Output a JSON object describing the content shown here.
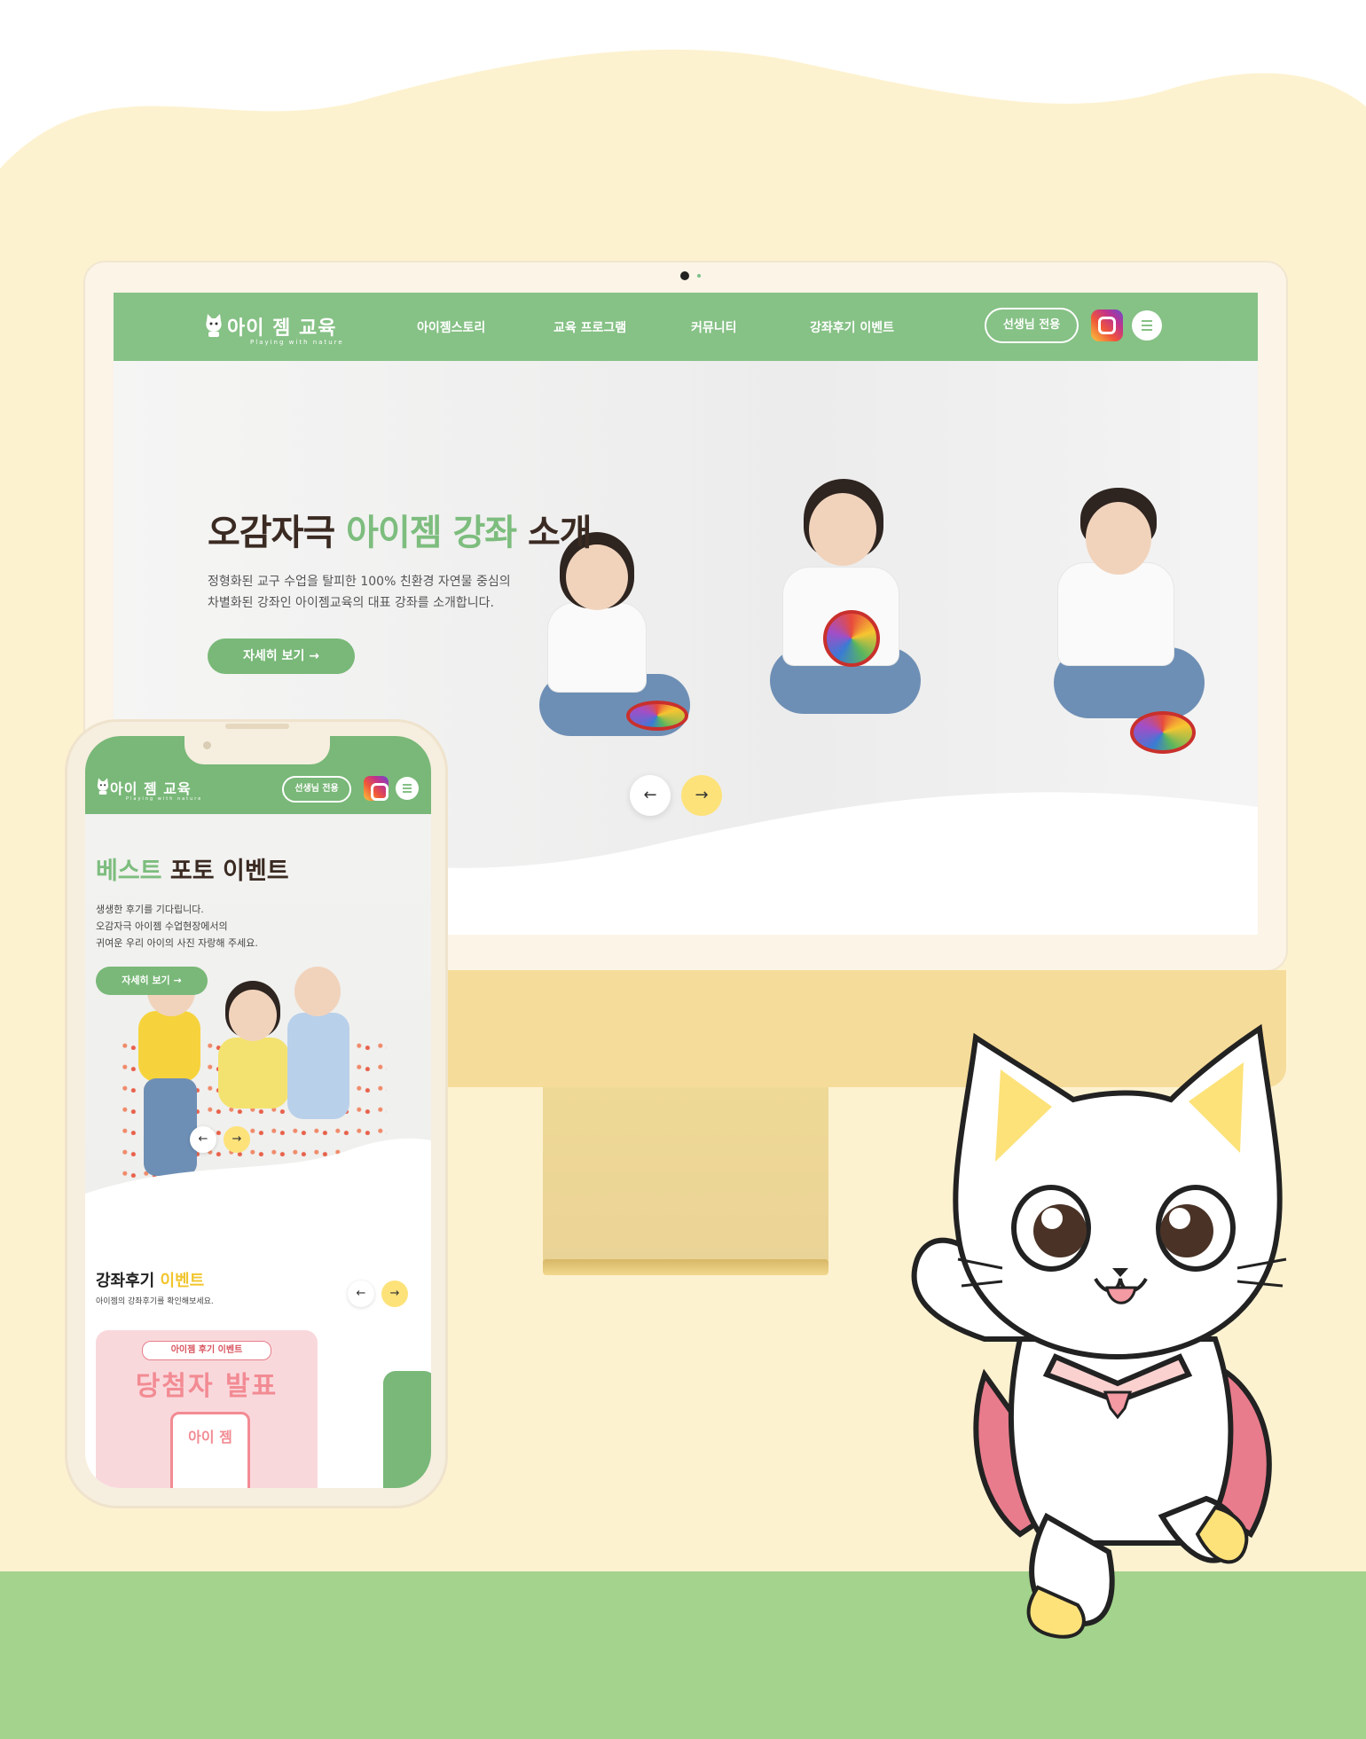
{
  "colors": {
    "cream_bg": "#fdf2d0",
    "grass": "#a3d38c",
    "brand_green": "#86c186",
    "accent_green": "#7dbd7e",
    "yellow": "#fde27a",
    "dark_text": "#3a2a22"
  },
  "desktop": {
    "logo": {
      "text": "아이 젬 교육",
      "tagline": "Playing with nature"
    },
    "nav": [
      "아이젬스토리",
      "교육 프로그램",
      "커뮤니티",
      "강좌후기 이벤트"
    ],
    "teacher_button": "선생님 전용",
    "icons": {
      "instagram": "instagram-icon",
      "menu": "hamburger-menu-icon"
    },
    "hero": {
      "title_prefix": "오감자극 ",
      "title_highlight": "아이젬 강좌",
      "title_suffix": " 소개",
      "desc_line1": "정형화된 교구 수업을 탈피한 100% 친환경 자연물 중심의",
      "desc_line2": "차별화된 강좌인 아이젬교육의 대표 강좌를 소개합니다.",
      "cta": "자세히 보기 →",
      "prev": "←",
      "next": "→"
    }
  },
  "mobile": {
    "logo": {
      "text": "아이 젬 교육",
      "tagline": "Playing with nature"
    },
    "teacher_button": "선생님 전용",
    "hero": {
      "title_highlight": "베스트",
      "title_rest": " 포토 이벤트",
      "desc_line1": "생생한 후기를 기다립니다.",
      "desc_line2": "오감자극 아이젬 수업현장에서의",
      "desc_line3": "귀여운 우리 아이의 사진 자랑해 주세요.",
      "cta": "자세히 보기 →",
      "prev": "←",
      "next": "→"
    },
    "review": {
      "title_main": "강좌후기",
      "title_highlight": " 이벤트",
      "subtitle": "아이젬의 강좌후기를 확인해보세요.",
      "prev": "←",
      "next": "→",
      "card": {
        "badge": "아이젬 후기 이벤트",
        "headline": "당첨자 발표",
        "phone_logo": "아이 젬"
      }
    }
  }
}
